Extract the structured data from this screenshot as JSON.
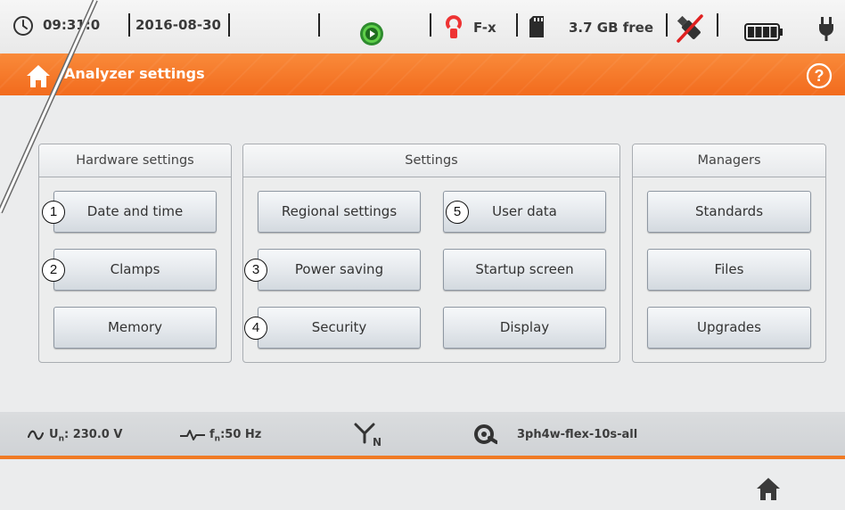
{
  "status": {
    "time": "09:31:0",
    "date": "2016-08-30",
    "clamp_type": "F-x",
    "storage": "3.7 GB free"
  },
  "header": {
    "title": "Analyzer settings"
  },
  "panels": {
    "hardware": {
      "title": "Hardware settings",
      "buttons": [
        "Date and time",
        "Clamps",
        "Memory"
      ]
    },
    "settings": {
      "title": "Settings",
      "buttons": [
        "Regional settings",
        "User data",
        "Power saving",
        "Startup screen",
        "Security",
        "Display"
      ]
    },
    "managers": {
      "title": "Managers",
      "buttons": [
        "Standards",
        "Files",
        "Upgrades"
      ]
    }
  },
  "callouts": [
    "1",
    "2",
    "3",
    "4",
    "5"
  ],
  "footer": {
    "voltage_label": "U",
    "voltage_sub": "n",
    "voltage_value": ": 230.0 V",
    "freq_label": "f",
    "freq_sub": "n",
    "freq_value": ":50 Hz",
    "config": "3ph4w-flex-10s-all",
    "n_sub": "N"
  },
  "colors": {
    "accent": "#f26b1d",
    "panel_border": "#a9adb2"
  },
  "icons": [
    "clock-icon",
    "play-icon",
    "clamp-icon",
    "sd-card-icon",
    "usb-disconnected-icon",
    "battery-icon",
    "plug-icon",
    "home-icon",
    "help-icon",
    "ac-wave-icon",
    "frequency-icon",
    "network-wye-icon",
    "config-icon"
  ]
}
